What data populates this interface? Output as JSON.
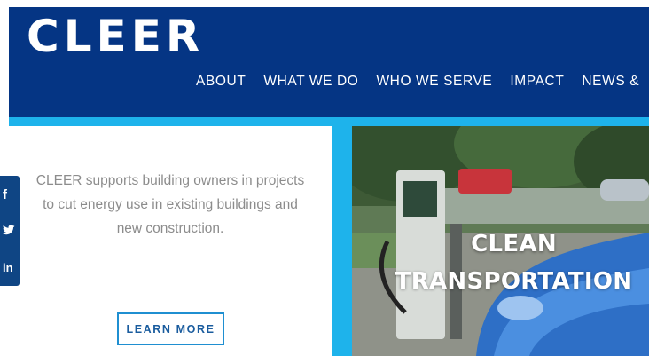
{
  "header": {
    "logo_text": "CLEER",
    "nav": [
      "ABOUT",
      "WHAT WE DO",
      "WHO WE SERVE",
      "IMPACT",
      "NEWS &"
    ]
  },
  "panel": {
    "text": "CLEER supports building owners in projects to cut energy use in existing buildings and new construction.",
    "button_label": "LEARN MORE"
  },
  "social": {
    "facebook_glyph": "f",
    "twitter_glyph": "🐦",
    "linkedin_glyph": "in"
  },
  "feature": {
    "caption_line1": "CLEAN",
    "caption_line2": "TRANSPORTATION"
  },
  "colors": {
    "header_bg": "#053584",
    "accent_band": "#1eb3eb",
    "button_border": "#1f8fd1",
    "social_bg": "#0f4584"
  }
}
